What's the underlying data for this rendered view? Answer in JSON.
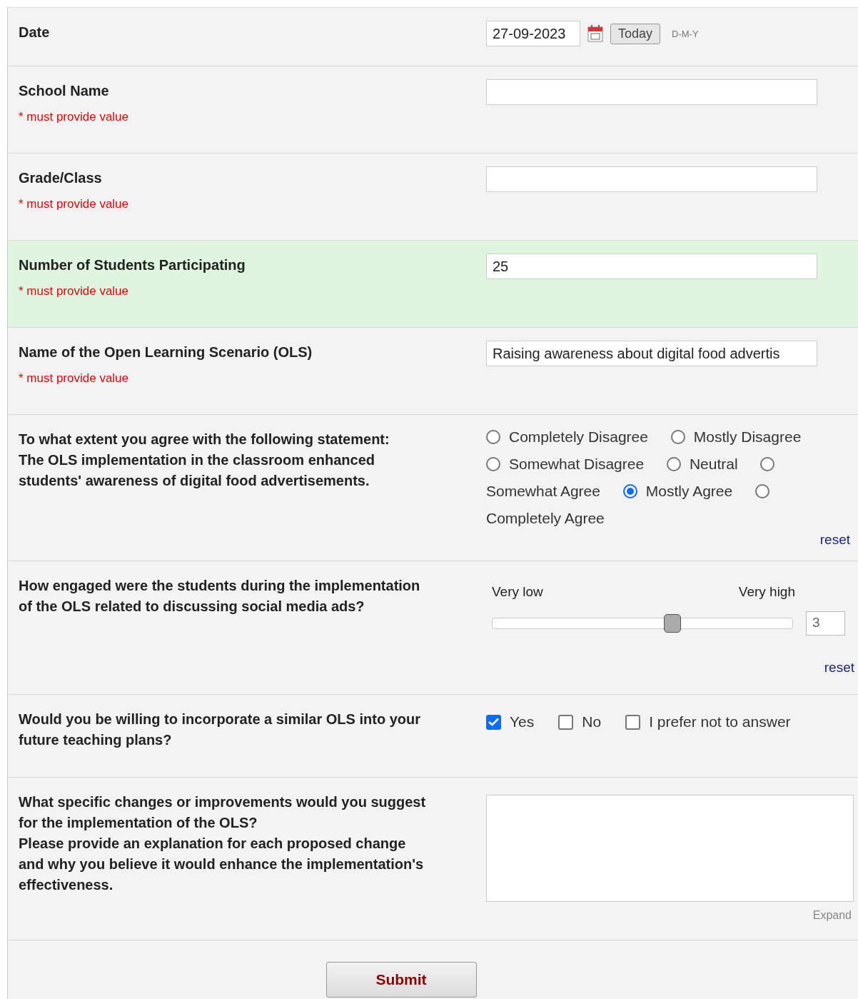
{
  "rows": [
    {
      "kind": "date",
      "label": "Date",
      "value": "27-09-2023",
      "button": "Today",
      "format": "D-M-Y",
      "highlighted": false
    },
    {
      "kind": "text",
      "label": "School Name",
      "note": "* must provide value",
      "highlighted": false
    },
    {
      "kind": "text",
      "label": "Grade/Class",
      "note": "* must provide value",
      "highlighted": false
    },
    {
      "kind": "text",
      "label": "Number of Students Participating",
      "note": "* must provide value",
      "value": "25",
      "highlighted": true
    },
    {
      "kind": "text",
      "label": "Name of the Open Learning Scenario (OLS)",
      "note": "* must provide value",
      "value": "Raising awareness about digital food advertis",
      "highlighted": false
    },
    {
      "kind": "radio",
      "label": "To what extent you agree with the following statement:\nThe OLS implementation in the classroom enhanced students' awareness of digital food advertisements.",
      "options": [
        {
          "label": "Completely Disagree",
          "selected": false
        },
        {
          "label": "Mostly Disagree",
          "selected": false
        },
        {
          "label": "Somewhat Disagree",
          "selected": false
        },
        {
          "label": "Neutral",
          "selected": false
        },
        {
          "label": "Somewhat Agree",
          "selected": false
        },
        {
          "label": "Mostly Agree",
          "selected": true
        },
        {
          "label": "Completely Agree",
          "selected": false
        }
      ],
      "reset": "reset",
      "highlighted": false
    },
    {
      "kind": "slider",
      "label": "How engaged were the students during the implementation of the OLS related to discussing social media ads?",
      "min_label": "Very low",
      "max_label": "Very high",
      "level": 0.6,
      "reading": "3",
      "reset": "reset",
      "highlighted": false
    },
    {
      "kind": "checkbox",
      "label": "Would you be willing to incorporate a similar OLS into your future teaching plans?",
      "options": [
        {
          "label": "Yes",
          "checked": true
        },
        {
          "label": "No",
          "checked": false
        },
        {
          "label": "I prefer not to answer",
          "checked": false
        }
      ],
      "highlighted": false
    },
    {
      "kind": "textarea",
      "label": "What specific changes or improvements would you suggest for the implementation of the OLS?\nPlease provide an explanation for each proposed change and why you believe it would enhance the implementation's effectiveness.",
      "expand": "Expand",
      "highlighted": false
    }
  ],
  "submit": "Submit"
}
